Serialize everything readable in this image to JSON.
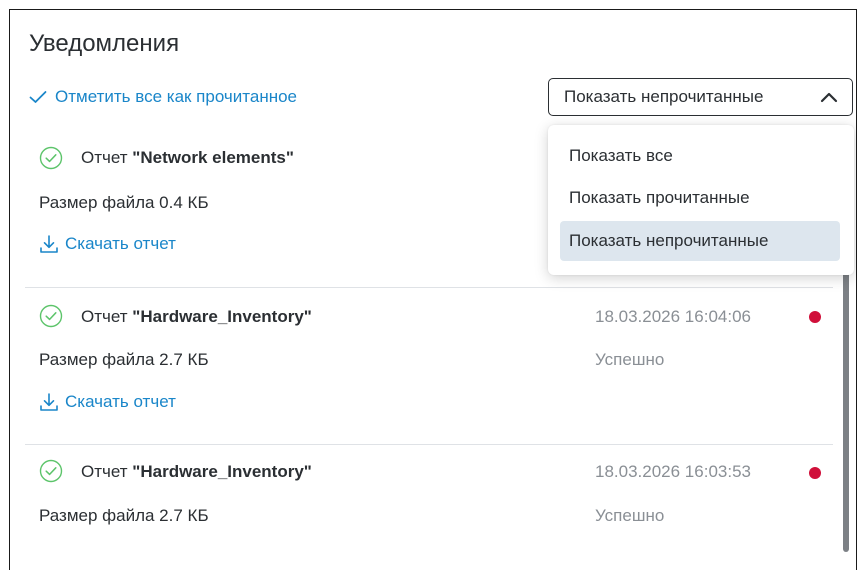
{
  "header": {
    "title": "Уведомления",
    "mark_all_label": "Отметить все как прочитанное"
  },
  "filter": {
    "selected": "Показать непрочитанные",
    "options": [
      "Показать все",
      "Показать прочитанные",
      "Показать непрочитанные"
    ],
    "active_index": 2
  },
  "reports": [
    {
      "prefix": "Отчет",
      "name": "\"Network elements\"",
      "size": "Размер файла 0.4 КБ",
      "download": "Скачать отчет"
    },
    {
      "prefix": "Отчет",
      "name": "\"Hardware_Inventory\"",
      "size": "Размер файла 2.7 КБ",
      "download": "Скачать отчет",
      "time": "18.03.2026 16:04:06",
      "status": "Успешно",
      "unread": true
    },
    {
      "prefix": "Отчет",
      "name": "\"Hardware_Inventory\"",
      "size": "Размер файла 2.7 КБ",
      "time": "18.03.2026 16:03:53",
      "status": "Успешно",
      "unread": true
    }
  ],
  "icons": {
    "check": "check-icon",
    "chevron": "chevron-up-icon",
    "success": "check-circle-icon",
    "download": "download-icon"
  },
  "colors": {
    "accent": "#1a86c9",
    "success": "#5cc46a",
    "unread_dot": "#d0103a",
    "muted": "#8a8f95",
    "highlight": "#dde6ee"
  }
}
